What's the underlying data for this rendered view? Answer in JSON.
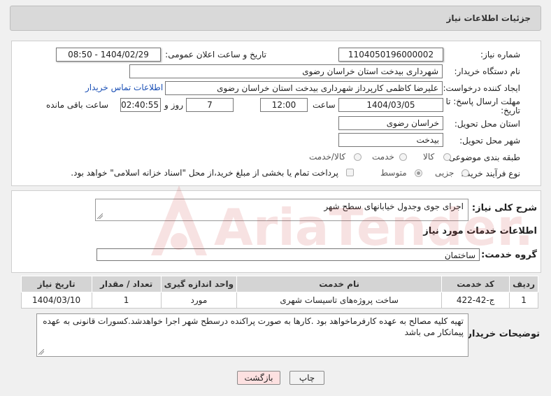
{
  "header": {
    "title": "جزئیات اطلاعات نیاز"
  },
  "form": {
    "need_number_label": "شماره نیاز:",
    "need_number": "1104050196000002",
    "announce_label": "تاریخ و ساعت اعلان عمومی:",
    "announce_value": "1404/02/29 - 08:50",
    "buyer_org_label": "نام دستگاه خریدار:",
    "buyer_org": "شهرداری بیدخت استان خراسان رضوی",
    "creator_label": "ایجاد کننده درخواست:",
    "creator": "علیرضا کاظمی کارپرداز شهرداری بیدخت استان خراسان رضوی",
    "contact_link": "اطلاعات تماس خریدار",
    "deadline_label_1": "مهلت ارسال پاسخ: تا",
    "deadline_label_2": "تاریخ:",
    "deadline_date": "1404/03/05",
    "time_label": "ساعت",
    "deadline_time": "12:00",
    "days_value": "7",
    "days_label": "روز و",
    "remaining_time": "02:40:55",
    "remaining_label": "ساعت باقی مانده",
    "province_label": "استان محل تحویل:",
    "province": "خراسان رضوی",
    "city_label": "شهر محل تحویل:",
    "city": "بیدخت",
    "category_label": "طبقه بندی موضوعی:",
    "category_options": [
      "کالا",
      "خدمت",
      "کالا/خدمت"
    ],
    "process_label": "نوع فرآیند خرید :",
    "process_options": [
      "جزیی",
      "متوسط"
    ],
    "payment_note": "پرداخت تمام یا بخشی از مبلغ خرید،از محل \"اسناد خزانه اسلامی\" خواهد بود."
  },
  "summary": {
    "label": "شرح کلی نیاز:",
    "text": "اجرای جوی وجدول خیابانهای سطح شهر"
  },
  "services": {
    "section_title": "اطلاعات خدمات مورد نیاز",
    "group_label": "گروه خدمت:",
    "group_value": "ساختمان",
    "columns": [
      "ردیف",
      "کد خدمت",
      "نام خدمت",
      "واحد اندازه گیری",
      "تعداد / مقدار",
      "تاریخ نیاز"
    ],
    "rows": [
      [
        "1",
        "ج-42-422",
        "ساخت پروژه‌های تاسیسات شهری",
        "مورد",
        "1",
        "1404/03/10"
      ]
    ]
  },
  "notes": {
    "label": "توضیحات خریدار:",
    "text": "تهیه کلیه مصالح به عهده کارفرماخواهد بود .کارها به صورت پراکنده درسطح شهر اجرا خواهدشد.کسورات قانونی به عهده پیمانکار می باشد"
  },
  "buttons": {
    "print": "چاپ",
    "back": "بازگشت"
  },
  "watermark": {
    "text": "AriaTender.neT"
  },
  "colors": {
    "link": "#1a4fb5",
    "back_button": "#fde1e1",
    "watermark": "#c62828"
  }
}
